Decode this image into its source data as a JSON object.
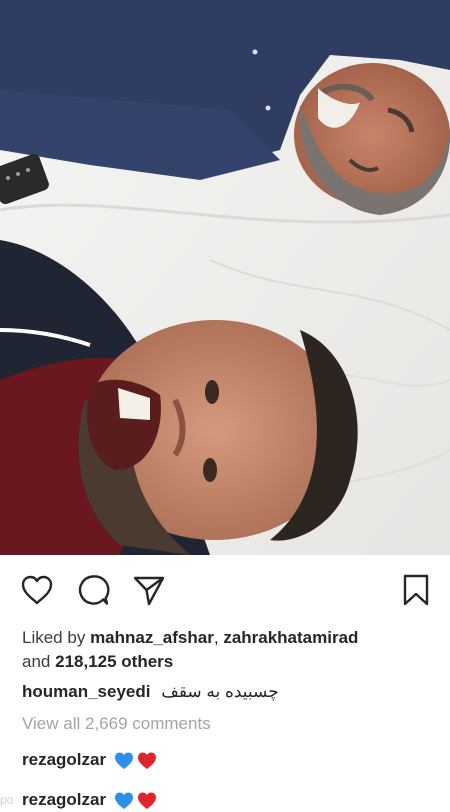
{
  "post": {
    "liked_by_prefix": "Liked by",
    "liked_user_1": "mahnaz_afshar",
    "separator": ",",
    "liked_user_2": "zahrakhatamirad",
    "and_text": "and",
    "others_text": "218,125 others",
    "caption_user": "houman_seyedi",
    "caption_text": "چسبیده به سقف",
    "view_all_comments": "View all 2,669 comments"
  },
  "comments": [
    {
      "user": "rezagolzar",
      "hearts": [
        "blue-heart",
        "red-heart"
      ]
    },
    {
      "user": "rezagolzar",
      "hearts": [
        "blue-heart",
        "red-heart"
      ]
    }
  ],
  "watermark": "po",
  "colors": {
    "text": "#262626",
    "muted": "#a4a4a4",
    "blue_heart": "#2e8fe6",
    "red_heart": "#e0242c"
  },
  "icons": {
    "like": "heart-outline-icon",
    "comment": "comment-bubble-icon",
    "share": "paper-plane-icon",
    "save": "bookmark-icon"
  }
}
